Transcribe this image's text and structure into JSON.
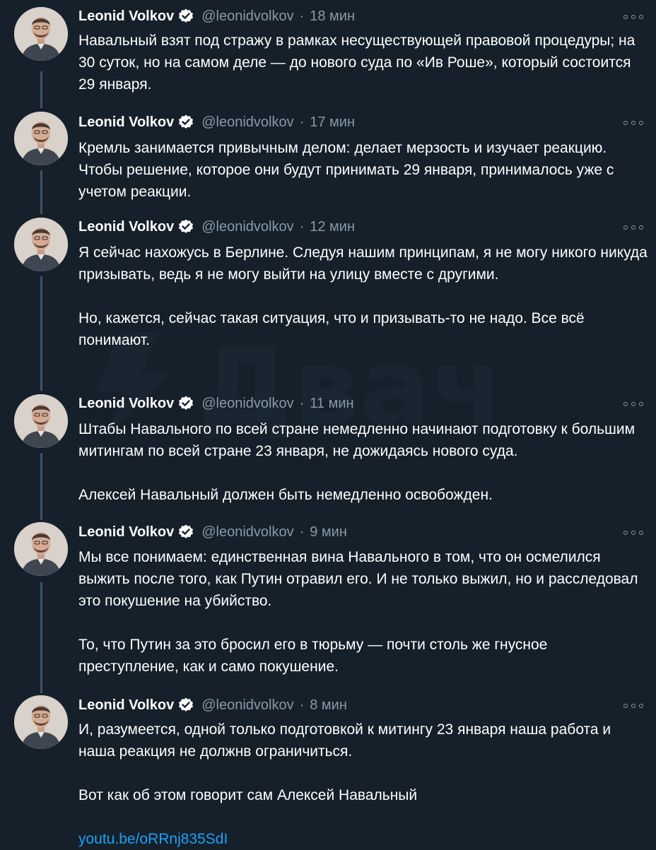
{
  "author": {
    "name": "Leonid Volkov",
    "handle": "@leonidvolkov",
    "verified": true
  },
  "tweets": [
    {
      "time": "18 мин",
      "paragraphs": [
        "Навальный взят под стражу в рамках несуществующей правовой процедуры; на 30 суток, но на самом деле — до нового суда по «Ив Роше», который состоится 29 января."
      ]
    },
    {
      "time": "17 мин",
      "paragraphs": [
        "Кремль занимается привычным делом: делает мерзость и изучает реакцию. Чтобы решение, которое они будут принимать 29 января, принималось уже с учетом реакции."
      ]
    },
    {
      "time": "12 мин",
      "paragraphs": [
        "Я сейчас нахожусь в Берлине. Следуя нашим принципам, я не могу никого никуда призывать, ведь я не могу выйти на улицу вместе с другими.",
        "Но, кажется, сейчас такая ситуация, что и призывать-то не надо. Все всё понимают."
      ]
    },
    {
      "time": "11 мин",
      "paragraphs": [
        "Штабы Навального по всей стране немедленно начинают подготовку к большим митингам по всей стране 23 января, не дожидаясь нового суда.",
        "Алексей Навальный должен быть немедленно освобожден."
      ]
    },
    {
      "time": "9 мин",
      "paragraphs": [
        "Мы все понимаем: единственная вина Навального в том, что он осмелился выжить после того, как Путин отравил его. И не только выжил, но и расследовал это покушение на убийство.",
        "То, что Путин за это бросил его в тюрьму — почти столь же гнусное преступление, как и само покушение."
      ]
    },
    {
      "time": "8 мин",
      "paragraphs": [
        "И, разумеется, одной только подготовкой к митингу 23 января наша работа и наша реакция не должнв ограничиться.",
        "Вот как об этом говорит сам Алексей Навальный"
      ],
      "link": "youtu.be/oRRnj835SdI"
    }
  ],
  "colors": {
    "background": "#15202b",
    "text": "#ffffff",
    "secondary": "#8899a6",
    "link": "#1da1f2",
    "thread_line": "#3d5466",
    "verified_badge": "#ffffff"
  }
}
